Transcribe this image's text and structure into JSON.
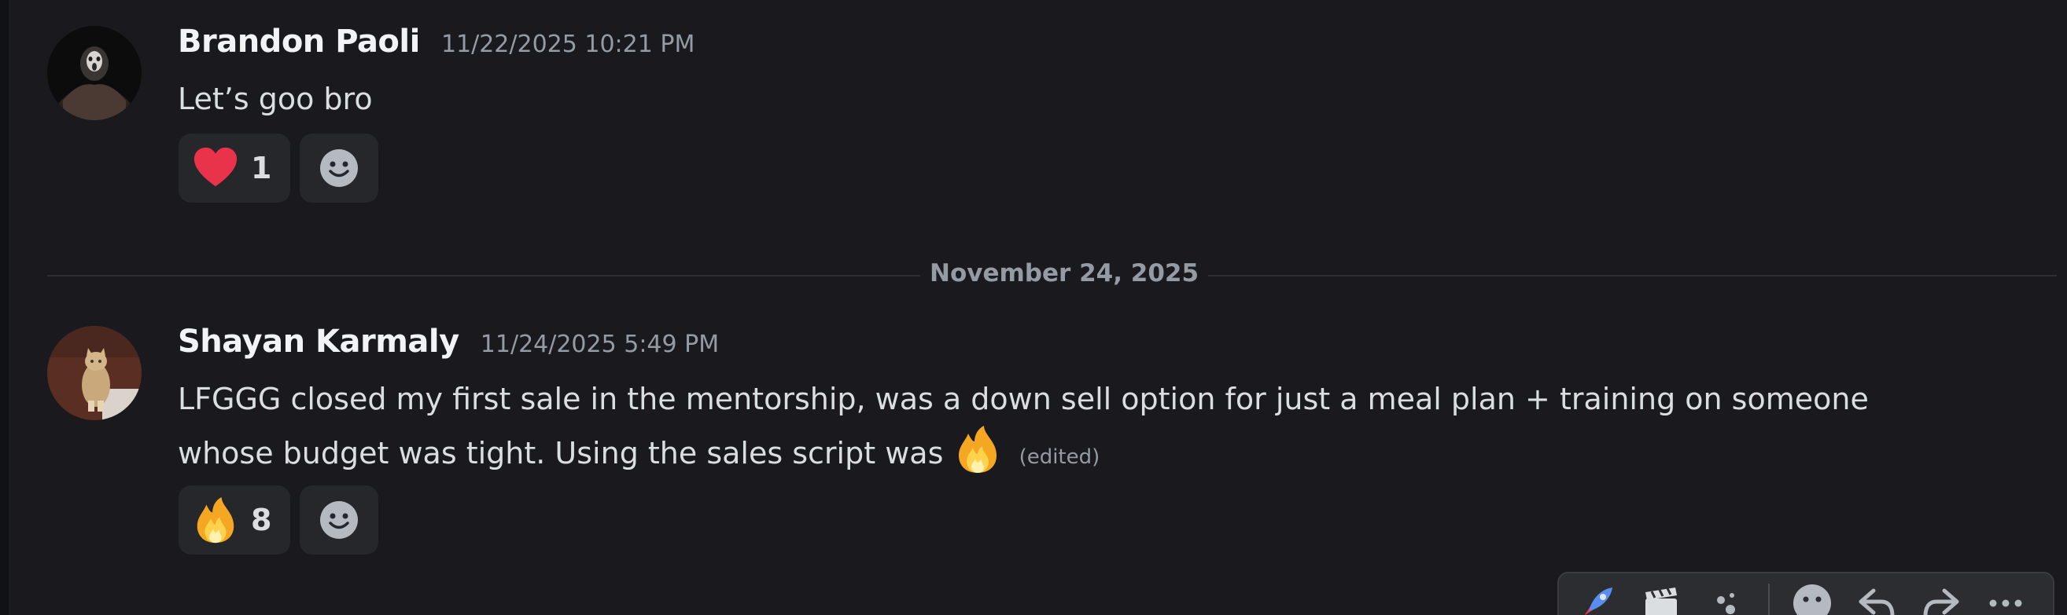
{
  "messages": [
    {
      "username": "Brandon Paoli",
      "timestamp": "11/22/2025 10:21 PM",
      "text": "Let’s goo bro",
      "reactions": [
        {
          "emoji": "heart-emoji",
          "count": "1"
        }
      ]
    },
    {
      "username": "Shayan Karmaly",
      "timestamp": "11/24/2025 5:49 PM",
      "text_line1": "LFGGG closed my first sale in the mentorship, was a down sell option for just a meal plan + training on someone",
      "text_line2": "whose budget was tight. Using the sales script was",
      "inline_emoji": "fire-emoji",
      "edited_label": "(edited)",
      "reactions": [
        {
          "emoji": "fire-emoji",
          "count": "8"
        }
      ]
    }
  ],
  "date_divider": "November 24, 2025",
  "toolbar": {
    "icons": [
      "rocket-icon",
      "clapperboard-icon",
      "sparkle-icon",
      "add-reaction-icon",
      "reply-icon",
      "forward-icon",
      "more-icon"
    ]
  },
  "colors": {
    "background": "#1a1a1e",
    "reaction_bg": "#26272b",
    "username": "#f2f3f5",
    "muted": "#949ba4",
    "heart": "#e8334a",
    "fire": "#f5a623"
  }
}
